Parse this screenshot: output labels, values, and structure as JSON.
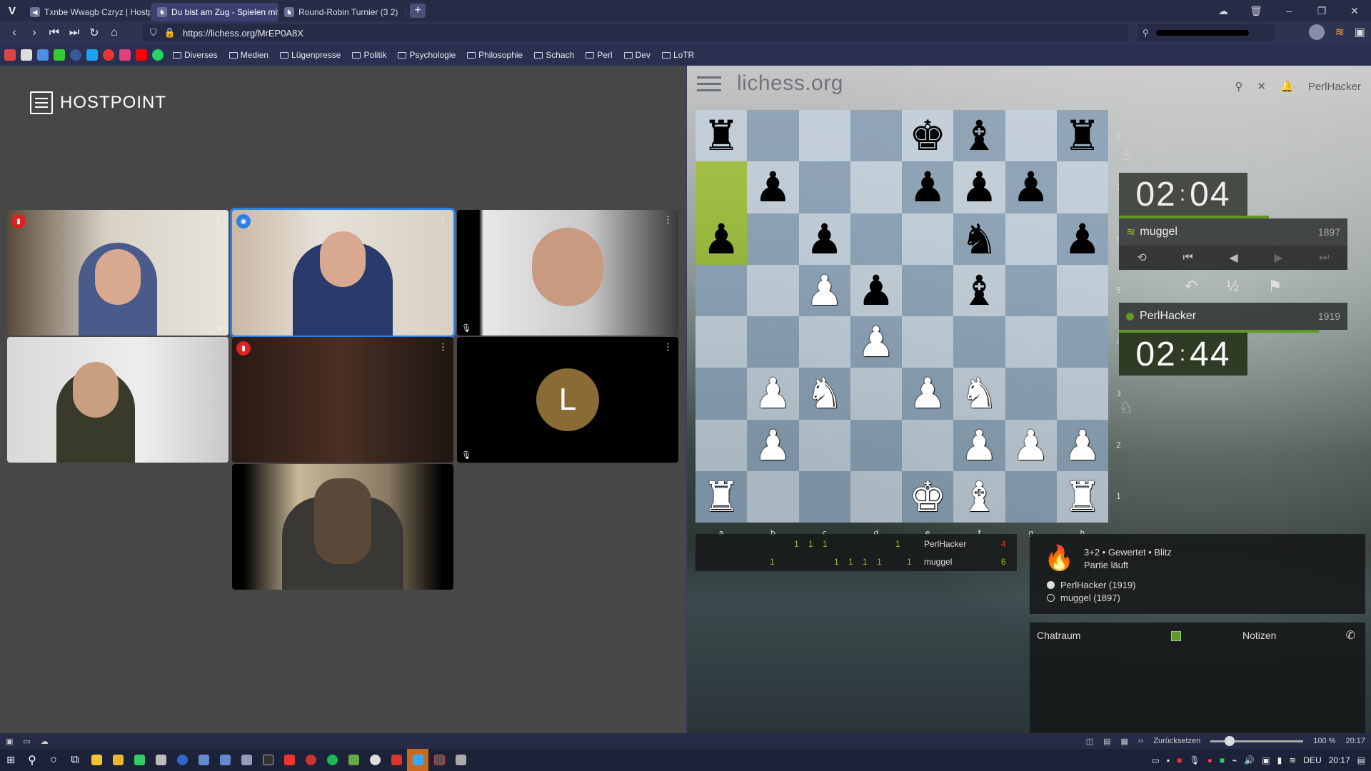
{
  "browser": {
    "tabs": [
      {
        "label": "Txnbe Wwagb Czryz | Hostpoint",
        "icon": "hostpoint-icon"
      },
      {
        "label": "Du bist am Zug - Spielen mit",
        "icon": "lichess-icon"
      },
      {
        "label": "Round-Robin Turnier (3 2)",
        "icon": "lichess-icon"
      }
    ],
    "new_tab": "+",
    "url": "https://lichess.org/MrEP0A8X",
    "bookmarks": [
      "Diverses",
      "Medien",
      "Lügenpresse",
      "Politik",
      "Psychologie",
      "Philosophie",
      "Schach",
      "Perl",
      "Dev",
      "LoTR"
    ]
  },
  "video": {
    "brand": "HOSTPOINT",
    "avatar_letter": "L"
  },
  "lichess": {
    "site": "lichess.org",
    "user": "PerlHacker",
    "opponent": {
      "name": "muggel",
      "rating": "1897",
      "clock_min": "02",
      "clock_sec": "04"
    },
    "me": {
      "name": "PerlHacker",
      "rating": "1919",
      "clock_min": "02",
      "clock_sec": "44"
    },
    "draw": "½",
    "files": [
      "a",
      "b",
      "c",
      "d",
      "e",
      "f",
      "g",
      "h"
    ],
    "ranks": [
      "8",
      "7",
      "6",
      "5",
      "4",
      "3",
      "2",
      "1"
    ],
    "board": [
      [
        "br",
        "",
        "",
        "",
        "bk",
        "bb",
        "",
        "br"
      ],
      [
        "",
        "bp",
        "",
        "",
        "bp",
        "bp",
        "bp",
        ""
      ],
      [
        "bp",
        "",
        "bp",
        "",
        "",
        "bn",
        "",
        "bp"
      ],
      [
        "",
        "",
        "wp",
        "bp",
        "",
        "bb",
        "",
        ""
      ],
      [
        "",
        "",
        "",
        "wp",
        "",
        "",
        "",
        ""
      ],
      [
        "",
        "wp",
        "wn",
        "",
        "wp",
        "wn",
        "",
        ""
      ],
      [
        "",
        "wp",
        "",
        "",
        "",
        "wp",
        "wp",
        "wp"
      ],
      [
        "wr",
        "",
        "",
        "",
        "wk",
        "wb",
        "",
        "wr"
      ]
    ],
    "crosstable": {
      "rows": [
        {
          "name": "PerlHacker",
          "score": "4",
          "cells": [
            "1",
            "1",
            "1",
            "1"
          ]
        },
        {
          "name": "muggel",
          "score": "6",
          "cells": [
            "1",
            "1",
            "1",
            "1",
            "1",
            "1"
          ]
        }
      ]
    },
    "game": {
      "setup": "3+2 • Gewertet • Blitz",
      "status": "Partie läuft",
      "white": "PerlHacker (1919)",
      "black": "muggel (1897)"
    },
    "chat_tab": "Chatraum",
    "notes_tab": "Notizen"
  },
  "statusbar": {
    "reset": "Zurücksetzen",
    "zoom": "100 %",
    "time": "20:17"
  },
  "taskbar": {
    "lang": "DEU",
    "time": "20:17"
  },
  "colors": {
    "accent": "#629924",
    "browser": "#272b46"
  }
}
